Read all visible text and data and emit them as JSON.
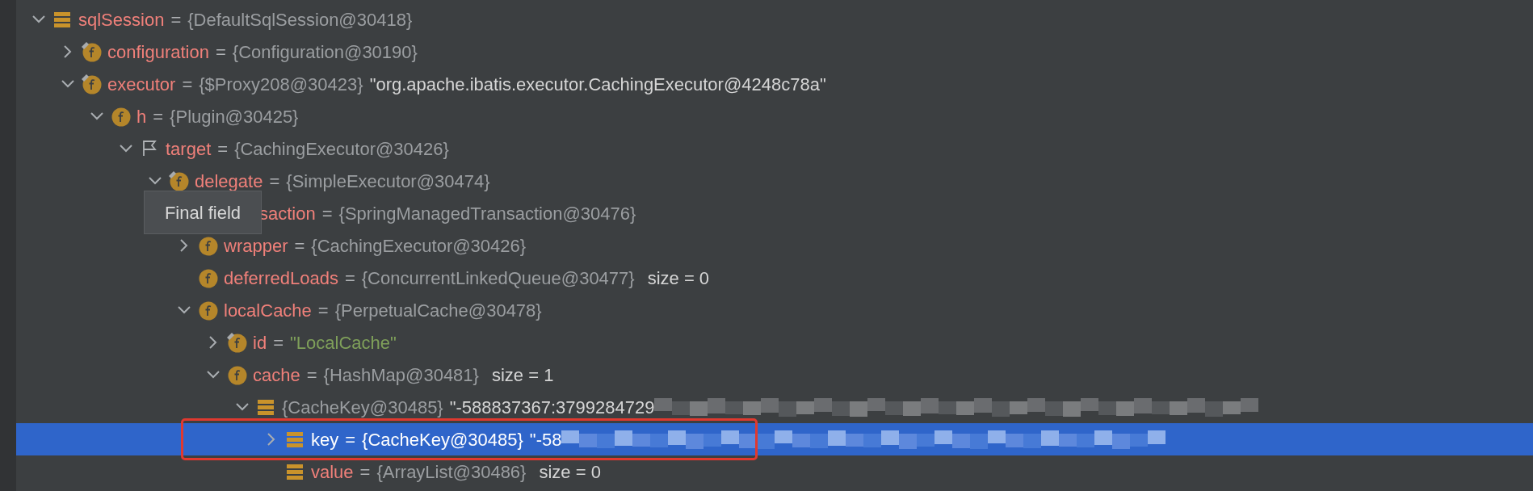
{
  "tree": [
    {
      "name": "sqlSession",
      "kind": "stack",
      "expanded": true,
      "eq": "=",
      "value": "{DefaultSqlSession@30418}",
      "children": [
        {
          "name": "configuration",
          "kind": "final-field",
          "expanded": false,
          "eq": "=",
          "value": "{Configuration@30190}"
        },
        {
          "name": "executor",
          "kind": "final-field",
          "expanded": true,
          "eq": "=",
          "value": "{$Proxy208@30423}",
          "note": "\"org.apache.ibatis.executor.CachingExecutor@4248c78a\"",
          "children": [
            {
              "name": "h",
              "kind": "field",
              "expanded": true,
              "eq": "=",
              "value": "{Plugin@30425}",
              "children": [
                {
                  "name": "target",
                  "kind": "flag",
                  "expanded": true,
                  "eq": "=",
                  "value": "{CachingExecutor@30426}",
                  "children": [
                    {
                      "name": "delegate",
                      "kind": "final-field",
                      "expanded": true,
                      "eq": "=",
                      "value": "{SimpleExecutor@30474}",
                      "children": [
                        {
                          "name": "saction",
                          "kind": "covered",
                          "eq": "=",
                          "value": "{SpringManagedTransaction@30476}"
                        },
                        {
                          "name": "wrapper",
                          "kind": "field",
                          "expanded": false,
                          "eq": "=",
                          "value": "{CachingExecutor@30426}"
                        },
                        {
                          "name": "deferredLoads",
                          "kind": "field",
                          "eq": "=",
                          "value": "{ConcurrentLinkedQueue@30477}",
                          "size": "size = 0"
                        },
                        {
                          "name": "localCache",
                          "kind": "field",
                          "expanded": true,
                          "eq": "=",
                          "value": "{PerpetualCache@30478}",
                          "children": [
                            {
                              "name": "id",
                              "kind": "final-field",
                              "expanded": false,
                              "eq": "=",
                              "value": "\"LocalCache\"",
                              "literal": true
                            },
                            {
                              "name": "cache",
                              "kind": "field",
                              "expanded": true,
                              "eq": "=",
                              "value": "{HashMap@30481}",
                              "size": "size = 1",
                              "children": [
                                {
                                  "kind": "stack",
                                  "expanded": true,
                                  "value": "{CacheKey@30485}",
                                  "note": "\"-588837367:3799284729",
                                  "redacted": true,
                                  "children": [
                                    {
                                      "name": "key",
                                      "kind": "stack",
                                      "expanded": false,
                                      "eq": "=",
                                      "value": "{CacheKey@30485}",
                                      "note": "\"-58",
                                      "redacted": true,
                                      "selected": true
                                    },
                                    {
                                      "name": "value",
                                      "kind": "stack",
                                      "eq": "=",
                                      "value": "{ArrayList@30486}",
                                      "size": "size = 0"
                                    }
                                  ]
                                }
                              ]
                            }
                          ]
                        }
                      ]
                    }
                  ]
                }
              ]
            }
          ]
        }
      ]
    }
  ],
  "tooltip": {
    "text": "Final field"
  }
}
